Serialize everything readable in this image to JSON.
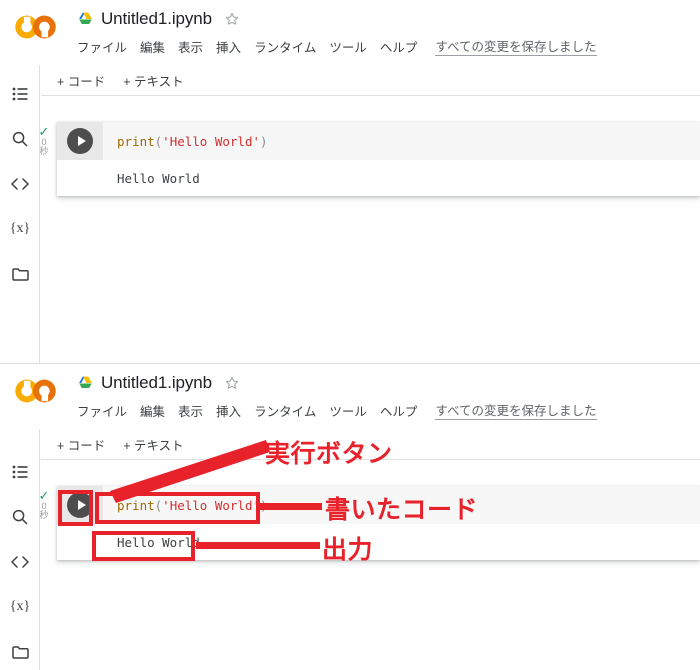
{
  "app": {
    "logo_name": "colab-logo",
    "doc_title": "Untitled1.ipynb",
    "drive_icon": "google-drive-icon",
    "star_icon": "star-outline-icon"
  },
  "menubar": {
    "items": [
      {
        "label": "ファイル"
      },
      {
        "label": "編集"
      },
      {
        "label": "表示"
      },
      {
        "label": "挿入"
      },
      {
        "label": "ランタイム"
      },
      {
        "label": "ツール"
      },
      {
        "label": "ヘルプ"
      }
    ],
    "save_status": "すべての変更を保存しました"
  },
  "toolbar": {
    "add_code": "+ コード",
    "add_text": "+ テキスト"
  },
  "sidebar": {
    "items": [
      {
        "name": "table-of-contents-icon",
        "glyph": "list"
      },
      {
        "name": "search-icon",
        "glyph": "search"
      },
      {
        "name": "code-snippets-icon",
        "glyph": "<>"
      },
      {
        "name": "variables-icon",
        "glyph": "{x}"
      },
      {
        "name": "files-folder-icon",
        "glyph": "folder"
      }
    ]
  },
  "cell": {
    "run_button_label": "run-cell",
    "code_tokens": {
      "fn": "print",
      "open": "(",
      "string": "'Hello World'",
      "close": ")"
    },
    "code_full": "print('Hello World')",
    "output": "Hello World",
    "exec_check": "✓",
    "exec_count": "0",
    "exec_unit": "秒"
  },
  "annotations": {
    "color": "#e8222b",
    "run_button": "実行ボタン",
    "written_code": "書いたコード",
    "output": "出力"
  }
}
